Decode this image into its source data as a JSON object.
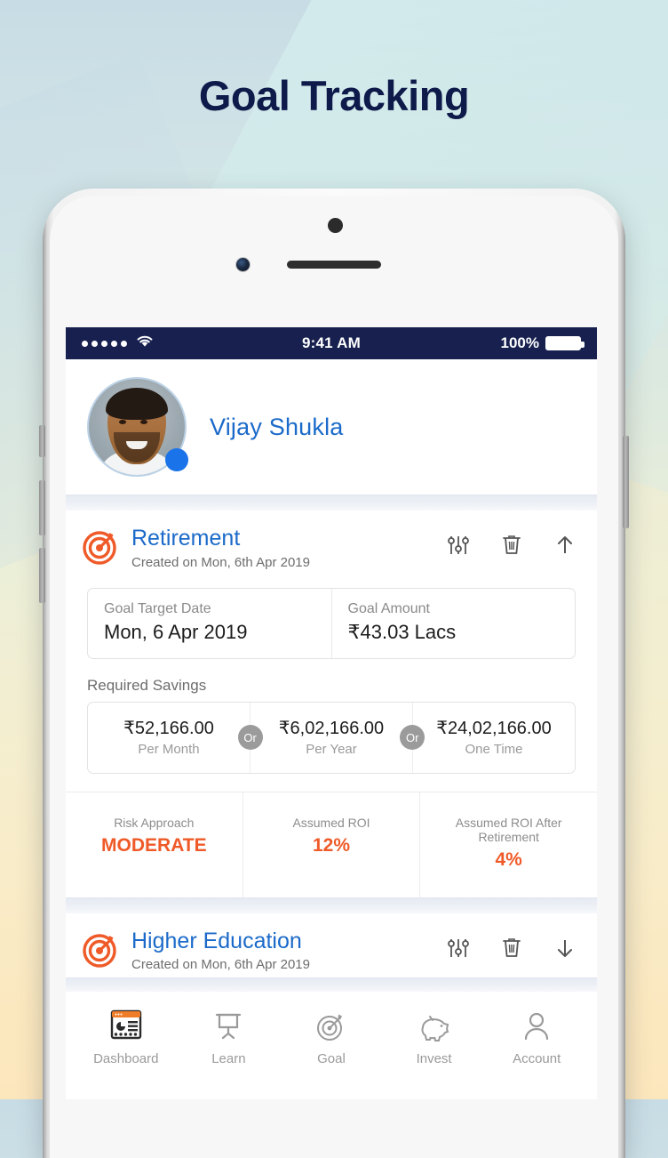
{
  "page": {
    "title": "Goal Tracking"
  },
  "status_bar": {
    "signal_dots": 5,
    "wifi_icon": "wifi-icon",
    "time": "9:41 AM",
    "battery_percent": "100%"
  },
  "profile": {
    "name": "Vijay Shukla",
    "avatar_icon": "avatar",
    "badge_icon": "status-badge-dot"
  },
  "goals": [
    {
      "icon": "target-goal-icon",
      "title": "Retirement",
      "created": "Created on Mon, 6th Apr 2019",
      "actions": [
        "tune-sliders-icon",
        "trash-icon",
        "chevron-up-icon"
      ],
      "expanded": true,
      "details": [
        {
          "label": "Goal Target Date",
          "value": "Mon, 6 Apr 2019"
        },
        {
          "label": "Goal Amount",
          "value": "₹43.03 Lacs"
        }
      ],
      "required_savings_label": "Required Savings",
      "required_savings": [
        {
          "amount": "₹52,166.00",
          "unit": "Per Month"
        },
        {
          "amount": "₹6,02,166.00",
          "unit": "Per Year"
        },
        {
          "amount": "₹24,02,166.00",
          "unit": "One Time"
        }
      ],
      "or_separator": "Or",
      "stats": [
        {
          "label": "Risk Approach",
          "value": "MODERATE"
        },
        {
          "label": "Assumed ROI",
          "value": "12%"
        },
        {
          "label": "Assumed ROI After Retirement",
          "value": "4%"
        }
      ]
    },
    {
      "icon": "target-goal-icon",
      "title": "Higher Education",
      "created": "Created on Mon, 6th Apr 2019",
      "actions": [
        "tune-sliders-icon",
        "trash-icon",
        "chevron-down-icon"
      ],
      "expanded": false
    }
  ],
  "tabbar": [
    {
      "icon": "dashboard-icon",
      "label": "Dashboard",
      "active": true
    },
    {
      "icon": "learn-board-icon",
      "label": "Learn",
      "active": false
    },
    {
      "icon": "goal-target-icon",
      "label": "Goal",
      "active": false
    },
    {
      "icon": "piggy-bank-icon",
      "label": "Invest",
      "active": false
    },
    {
      "icon": "person-icon",
      "label": "Account",
      "active": false
    }
  ],
  "colors": {
    "accent_orange": "#ef5a28",
    "link_blue": "#1b6ac9",
    "status_bar_navy": "#17204f",
    "title_navy": "#0d1a4a"
  }
}
